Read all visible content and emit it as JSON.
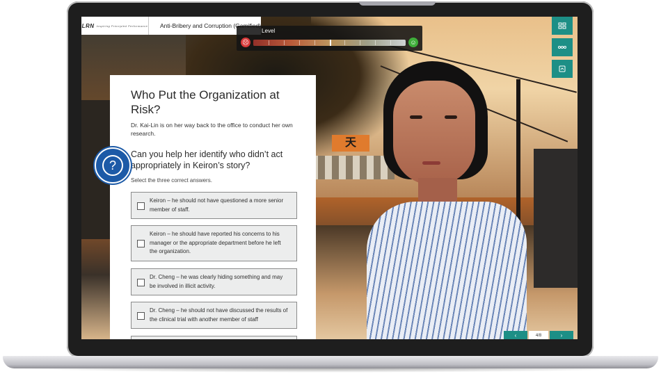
{
  "header": {
    "logo_text": "LRN",
    "logo_tagline": "Inspiring Principled Performance",
    "course_title": "Anti-Bribery and Corruption (Gamified)"
  },
  "level_meter": {
    "label": "Level",
    "value_fraction": 0.5,
    "low_icon": "sad-face-icon",
    "high_icon": "happy-face-icon"
  },
  "tools": [
    {
      "icon": "menu-icon"
    },
    {
      "icon": "more-options-icon"
    },
    {
      "icon": "resource-icon"
    }
  ],
  "question_panel": {
    "title": "Who Put the Organization at Risk?",
    "intro": "Dr. Kai-Lin is on her way back to the office to conduct her own research.",
    "question": "Can you help her identify who didn’t act appropriately in Keiron’s story?",
    "instruction": "Select the three correct answers.",
    "options": [
      "Keiron – he should not have questioned a more senior member of staff.",
      "Keiron – he should have reported his concerns to his manager or the appropriate department before he left the organization.",
      "Dr. Cheng – he was clearly hiding something and may be involved in illicit activity.",
      "Dr. Cheng – he should not have discussed the results of the clinical trial with another member of staff"
    ]
  },
  "badge": {
    "icon": "question-mark-icon",
    "symbol": "?"
  },
  "nav": {
    "prev_icon": "previous-arrow-icon",
    "next_icon": "next-arrow-icon",
    "page_counter": "4/8"
  },
  "colors": {
    "accent": "#1d8f86",
    "badge": "#1c5aa7",
    "panel": "#ffffff",
    "option_bg": "#eceded"
  }
}
